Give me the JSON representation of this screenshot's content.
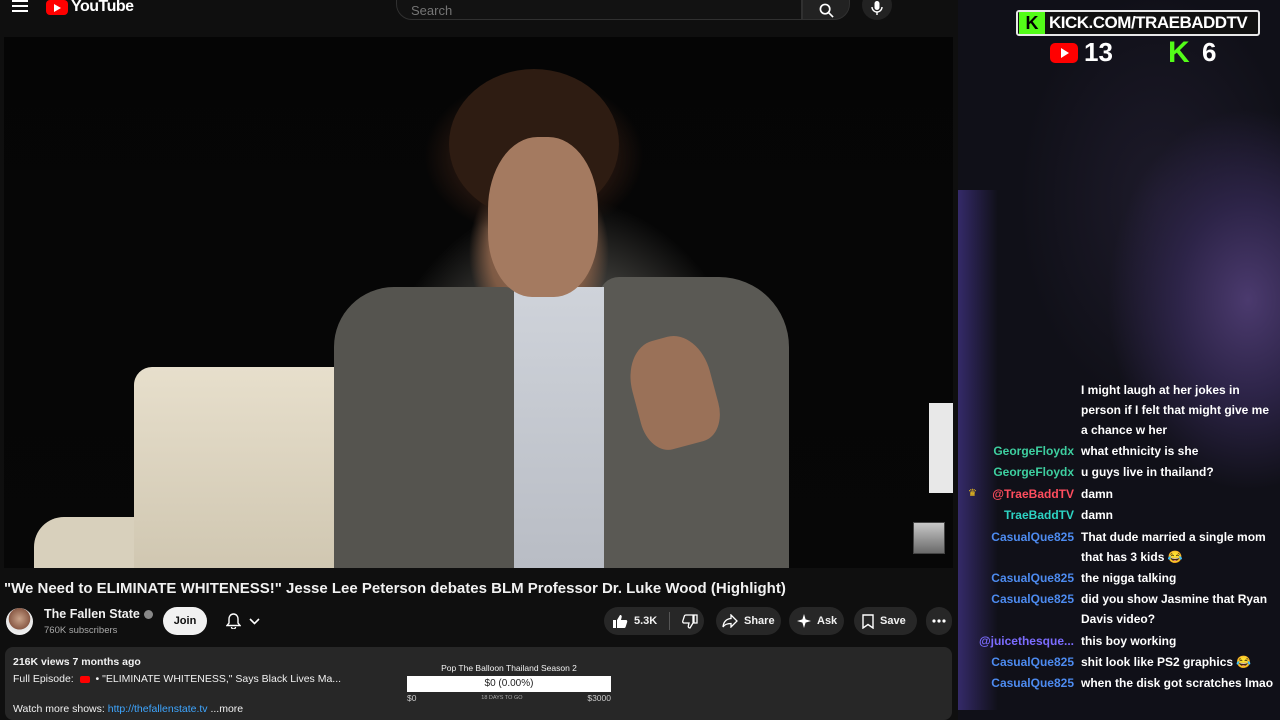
{
  "header": {
    "logo_text": "YouTube",
    "search_placeholder": "Search"
  },
  "video": {
    "title": "\"We Need to ELIMINATE WHITENESS!\" Jesse Lee Peterson debates BLM Professor Dr. Luke Wood (Highlight)"
  },
  "channel": {
    "name": "The Fallen State",
    "subscribers": "760K subscribers",
    "join_label": "Join"
  },
  "actions": {
    "likes": "5.3K",
    "share": "Share",
    "ask": "Ask",
    "save": "Save"
  },
  "description": {
    "stats": "216K views  7 months ago",
    "episode_label": "Full Episode:",
    "episode_text": "• \"ELIMINATE WHITENESS,\" Says Black Lives Ma...",
    "watch_label": "Watch more shows:",
    "watch_link": "http://thefallenstate.tv",
    "more": "...more"
  },
  "goal": {
    "title": "Pop The Balloon Thailand Season 2",
    "amount": "$0 (0.00%)",
    "progress_percent": 0,
    "start": "$0",
    "days_left": "18 DAYS TO GO",
    "target": "$3000"
  },
  "overlay": {
    "kick_url": "KICK.COM/TRAEBADDTV",
    "kick_letter": "K",
    "youtube_viewers": "13",
    "kick_viewers": "6"
  },
  "chat": [
    {
      "user": "",
      "text": "I might laugh at her jokes in person if I felt that might give me a chance w her",
      "color": "#3ecfa0"
    },
    {
      "user": "GeorgeFloydx",
      "text": "what ethnicity is she",
      "color": "#3ecfa0"
    },
    {
      "user": "GeorgeFloydx",
      "text": "u guys live in thailand?",
      "color": "#3ecfa0"
    },
    {
      "user": "@TraeBaddTV",
      "text": "damn",
      "color": "#ff4d5e"
    },
    {
      "user": "TraeBaddTV",
      "text": "damn",
      "color": "#2dd4c4"
    },
    {
      "user": "CasualQue825",
      "text": "That dude married a single mom that has 3 kids 😂",
      "color": "#4d8bf0"
    },
    {
      "user": "CasualQue825",
      "text": "the nigga talking",
      "color": "#4d8bf0"
    },
    {
      "user": "CasualQue825",
      "text": "did you show Jasmine that Ryan Davis video?",
      "color": "#4d8bf0"
    },
    {
      "user": "@juicethesque...",
      "text": "this boy working",
      "color": "#7b6cff"
    },
    {
      "user": "CasualQue825",
      "text": "shit look like PS2 graphics 😂",
      "color": "#4d8bf0"
    },
    {
      "user": "CasualQue825",
      "text": "when the disk got scratches lmao",
      "color": "#4d8bf0"
    }
  ]
}
